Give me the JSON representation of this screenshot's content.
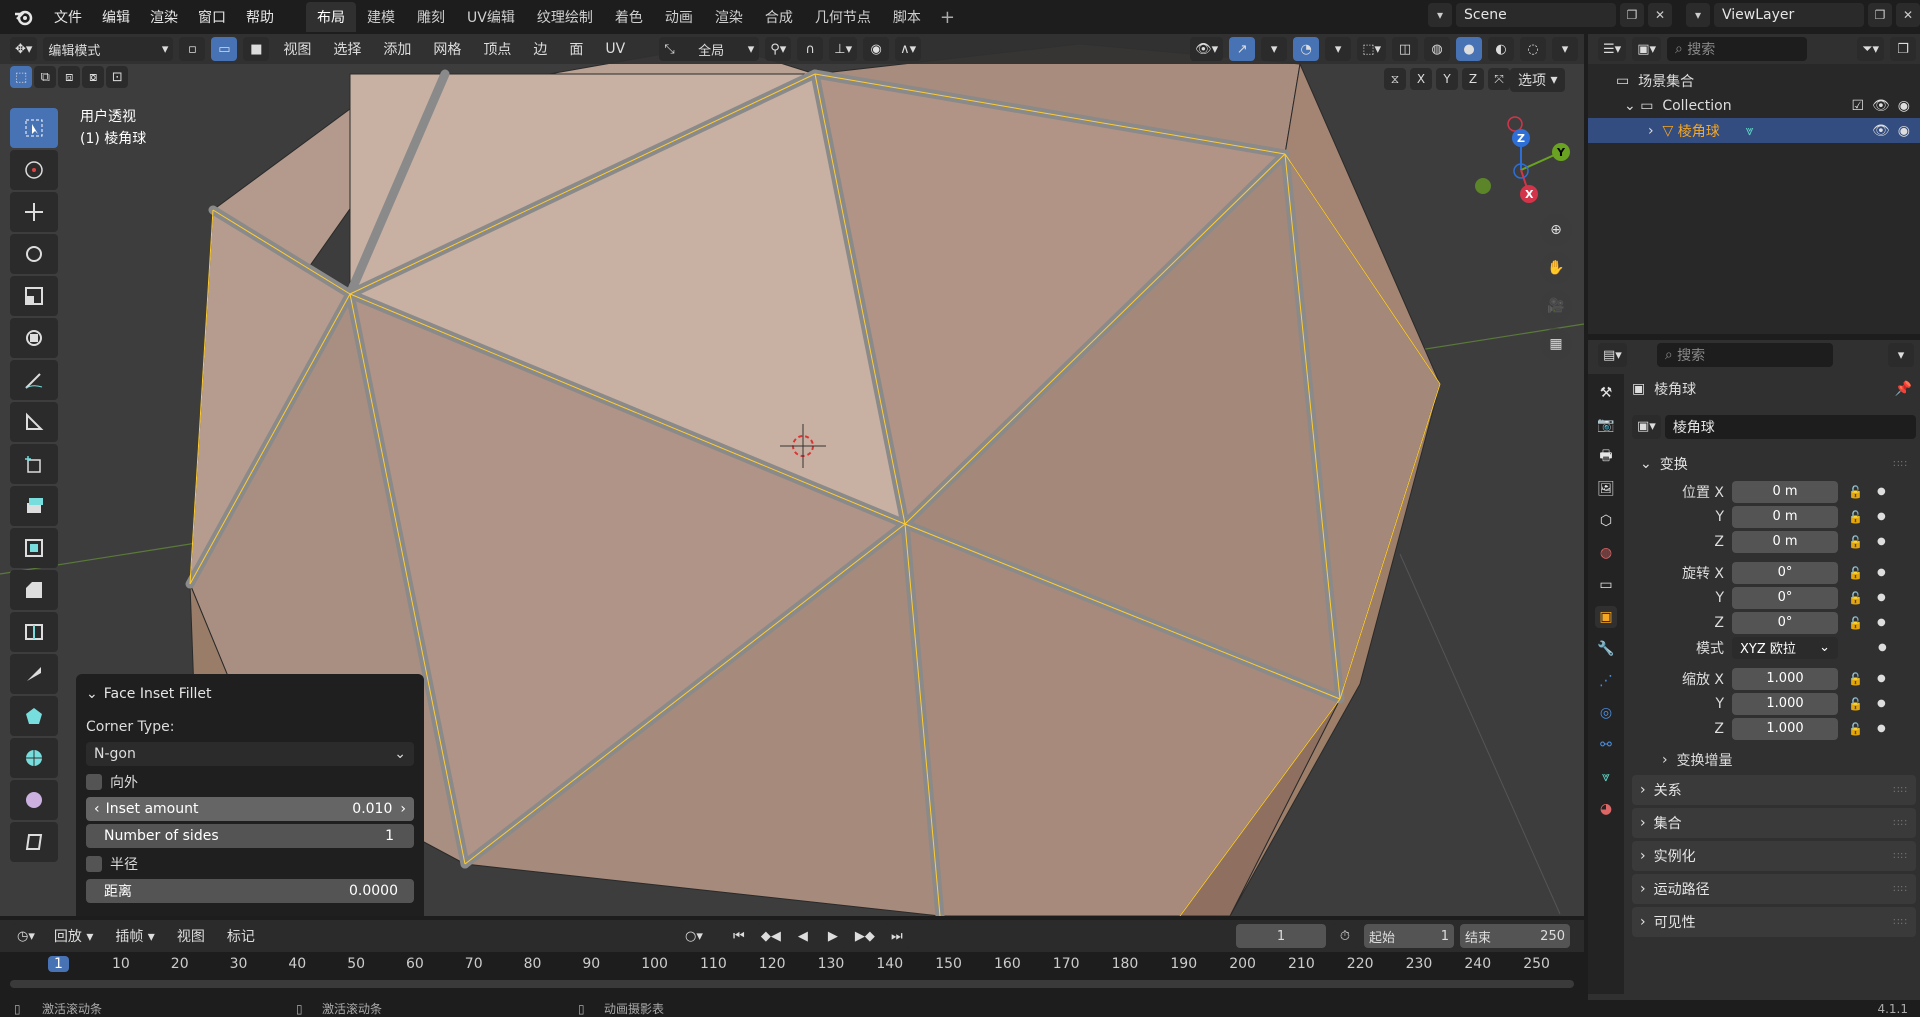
{
  "top": {
    "menus": [
      "文件",
      "编辑",
      "渲染",
      "窗口",
      "帮助"
    ],
    "tabs": [
      "布局",
      "建模",
      "雕刻",
      "UV编辑",
      "纹理绘制",
      "着色",
      "动画",
      "渲染",
      "合成",
      "几何节点",
      "脚本"
    ],
    "active_tab": "布局",
    "scene": "Scene",
    "view_layer": "ViewLayer"
  },
  "viewport": {
    "mode": "编辑模式",
    "menus": [
      "视图",
      "选择",
      "添加",
      "网格",
      "顶点",
      "边",
      "面",
      "UV"
    ],
    "transform_orientation": "全局",
    "view_label": "用户透视",
    "object_label": "(1) 棱角球",
    "options": "选项",
    "axis_x": "X",
    "axis_y": "Y",
    "axis_z": "Z"
  },
  "operator": {
    "title": "Face Inset Fillet",
    "corner_label": "Corner Type:",
    "corner_value": "N-gon",
    "outward": "向外",
    "inset_label": "Inset amount",
    "inset_value": "0.010",
    "sides_label": "Number of sides",
    "sides_value": "1",
    "radius": "半径",
    "distance_label": "距离",
    "distance_value": "0.0000"
  },
  "timeline": {
    "menus": [
      "回放",
      "插帧",
      "视图",
      "标记"
    ],
    "current_frame": "1",
    "start_label": "起始",
    "start_value": "1",
    "end_label": "结束",
    "end_value": "250",
    "frames": [
      "1",
      "10",
      "20",
      "30",
      "40",
      "50",
      "60",
      "70",
      "80",
      "90",
      "100",
      "110",
      "120",
      "130",
      "140",
      "150",
      "160",
      "170",
      "180",
      "190",
      "200",
      "210",
      "220",
      "230",
      "240",
      "250"
    ]
  },
  "status": {
    "left": "激活滚动条",
    "middle": "激活滚动条",
    "right": "动画摄影表",
    "version": "4.1.1"
  },
  "outliner": {
    "search_placeholder": "搜索",
    "scene_collection": "场景集合",
    "collection": "Collection",
    "object": "棱角球"
  },
  "properties": {
    "search_placeholder": "搜索",
    "object_name": "棱角球",
    "data_name": "棱角球",
    "transform": "变换",
    "location_label": "位置 X",
    "rotation_label": "旋转 X",
    "scale_label": "缩放 X",
    "y": "Y",
    "z": "Z",
    "loc": [
      "0 m",
      "0 m",
      "0 m"
    ],
    "rot": [
      "0°",
      "0°",
      "0°"
    ],
    "mode_label": "模式",
    "mode_value": "XYZ 欧拉",
    "scale": [
      "1.000",
      "1.000",
      "1.000"
    ],
    "delta": "变换增量",
    "sections": [
      "关系",
      "集合",
      "实例化",
      "运动路径",
      "可见性"
    ]
  },
  "colors": {
    "accent": "#4772b3",
    "face": "#b0968a",
    "edge": "#ffaa00"
  }
}
